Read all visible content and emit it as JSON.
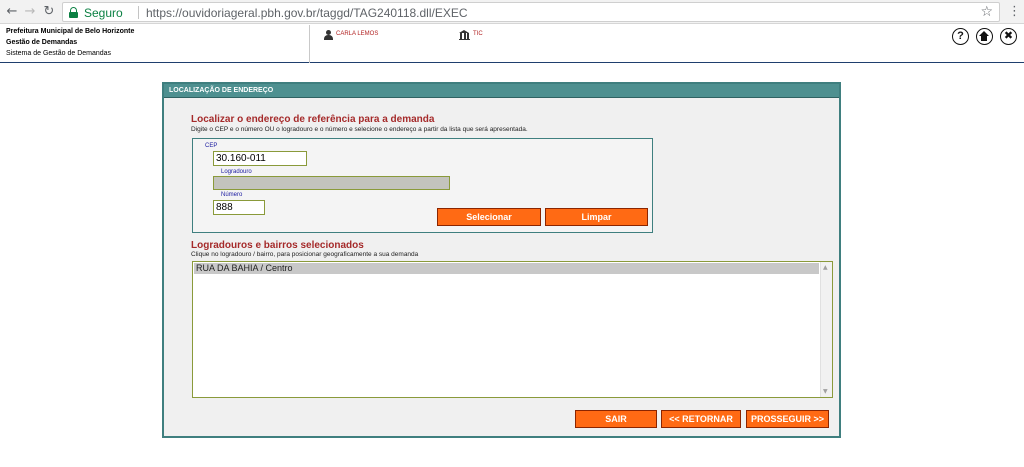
{
  "browser": {
    "back_icon": "←",
    "forward_icon": "→",
    "reload_icon": "↻",
    "secure_label": "Seguro",
    "url": "https://ouvidoriageral.pbh.gov.br/taggd/TAG240118.dll/EXEC",
    "star_icon": "☆",
    "menu_icon": "⋮"
  },
  "header": {
    "org_line1": "Prefeitura Municipal de Belo Horizonte",
    "org_line2": "Gestão de Demandas",
    "org_line3": "Sistema de Gestão de Demandas",
    "user_name": "CARLA LEMOS",
    "sector": "TIC",
    "help_label": "?",
    "close_label": "✖"
  },
  "panel": {
    "title": "LOCALIZAÇÃO DE ENDEREÇO",
    "search_title": "Localizar o endereço de referência para a demanda",
    "search_subtitle": "Digite o CEP e o número OU o logradouro e o número e selecione o endereço a partir da lista que será apresentada.",
    "cep_label": "CEP",
    "cep_value": "30.160-011",
    "logradouro_label": "Logradouro",
    "logradouro_value": "",
    "numero_label": "Número",
    "numero_value": "888",
    "select_button": "Selecionar",
    "clear_button": "Limpar",
    "results_title": "Logradouros e bairros selecionados",
    "results_subtitle": "Clique no logradouro / bairro, para posicionar geograficamente a sua demanda",
    "results": [
      "RUA DA BAHIA / Centro"
    ],
    "exit_button": "SAIR",
    "back_button": "<< RETORNAR",
    "next_button": "PROSSEGUIR >>"
  },
  "colors": {
    "accent_orange": "#ff6a14",
    "panel_teal": "#4e9090",
    "title_red": "#a52a2a",
    "secure_green": "#0b8043"
  }
}
